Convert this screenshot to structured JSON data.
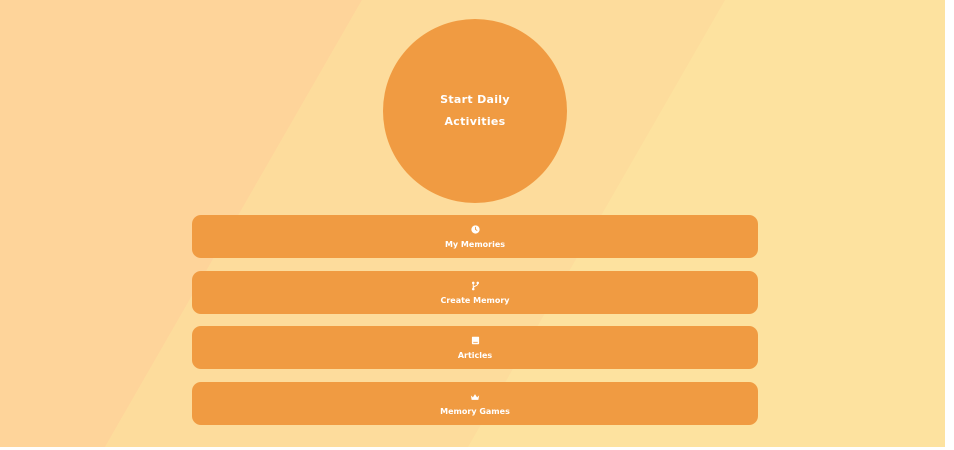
{
  "start": {
    "line1": "Start Daily",
    "line2": "Activities"
  },
  "menu": [
    {
      "label": "My Memories",
      "icon": "clock-icon"
    },
    {
      "label": "Create Memory",
      "icon": "branch-icon"
    },
    {
      "label": "Articles",
      "icon": "book-icon"
    },
    {
      "label": "Memory Games",
      "icon": "crown-icon"
    }
  ],
  "colors": {
    "accent": "#f09b42",
    "background_left": "#fed49a",
    "background_middle": "#fddc9c",
    "background_right": "#fde29f",
    "text": "#ffffff"
  }
}
